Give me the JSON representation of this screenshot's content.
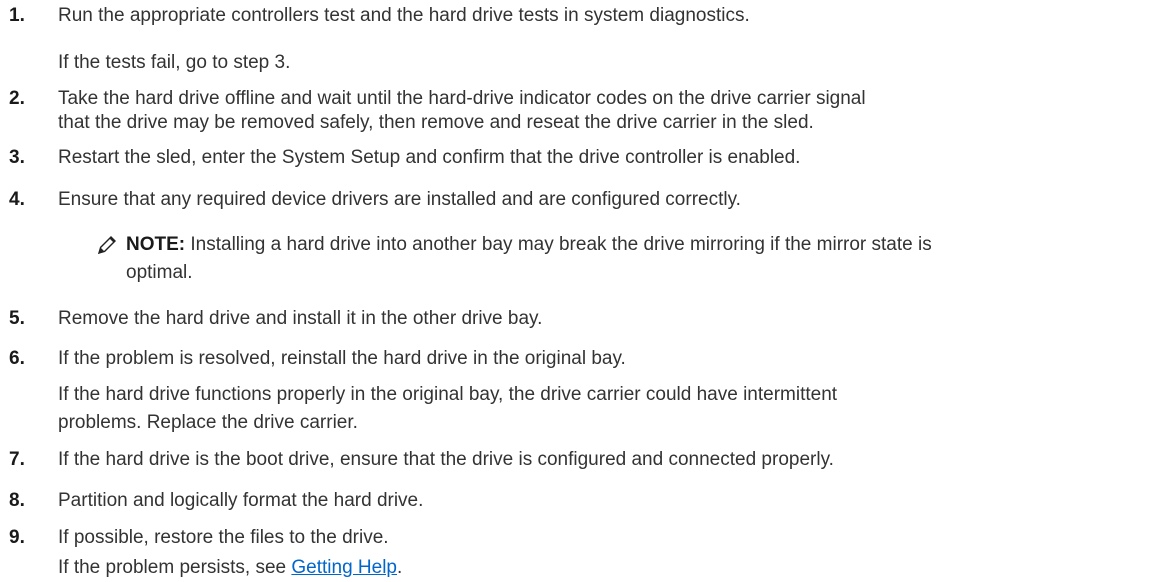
{
  "steps": [
    {
      "number": "1.",
      "lines": [
        "Run the appropriate controllers test and the hard drive tests in system diagnostics."
      ],
      "sub": [
        "If the tests fail, go to step 3."
      ]
    },
    {
      "number": "2.",
      "lines": [
        "Take the hard drive offline and wait until the hard-drive indicator codes on the drive carrier signal",
        "that the drive may be removed safely, then remove and reseat the drive carrier in the sled."
      ]
    },
    {
      "number": "3.",
      "lines": [
        "Restart the sled, enter the System Setup and confirm that the drive controller is enabled."
      ]
    },
    {
      "number": "4.",
      "lines": [
        "Ensure that any required device drivers are installed and are configured correctly."
      ]
    },
    {
      "number": "5.",
      "lines": [
        "Remove the hard drive and install it in the other drive bay."
      ]
    },
    {
      "number": "6.",
      "lines": [
        "If the problem is resolved, reinstall the hard drive in the original bay."
      ],
      "sub": [
        "If the hard drive functions properly in the original bay, the drive carrier could have intermittent",
        "problems. Replace the drive carrier."
      ]
    },
    {
      "number": "7.",
      "lines": [
        "If the hard drive is the boot drive, ensure that the drive is configured and connected properly."
      ]
    },
    {
      "number": "8.",
      "lines": [
        "Partition and logically format the hard drive."
      ]
    },
    {
      "number": "9.",
      "lines": [
        "If possible, restore the files to the drive."
      ],
      "sub_prefix": "If the problem persists, see ",
      "sub_link": "Getting Help",
      "sub_suffix": "."
    }
  ],
  "note": {
    "icon": "pencil-icon",
    "label": "NOTE:",
    "line1": " Installing a hard drive into another bay may break the drive mirroring if the mirror state is",
    "line2": "optimal."
  },
  "colors": {
    "text": "#333333",
    "link": "#0066cc"
  }
}
